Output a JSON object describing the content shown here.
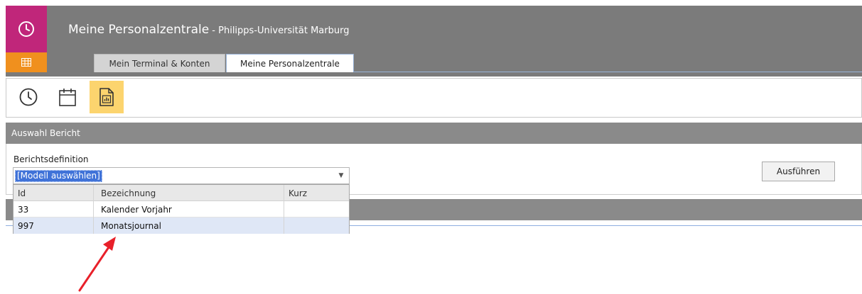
{
  "header": {
    "title": "Meine Personalzentrale",
    "subtitle": " - Philipps-Universität Marburg",
    "accent_colors": {
      "clock_tile": "#c0267a",
      "grid_tile": "#f0901e",
      "bar": "#7b7b7b"
    }
  },
  "side_icons": [
    "clock-icon",
    "grid-icon"
  ],
  "tabs": [
    {
      "label": "Mein Terminal & Konten",
      "active": false
    },
    {
      "label": "Meine Personalzentrale",
      "active": true
    }
  ],
  "toolbar": {
    "items": [
      {
        "icon": "clock-icon",
        "selected": false
      },
      {
        "icon": "calendar-icon",
        "selected": false
      },
      {
        "icon": "report-chart-icon",
        "selected": true
      }
    ],
    "selected_color": "#fcd46e"
  },
  "panel": {
    "title": "Auswahl Bericht",
    "field_label": "Berichtsdefinition",
    "select_value": "[Modell auswählen]",
    "run_label": "Ausführen"
  },
  "dropdown": {
    "columns": [
      "Id",
      "Bezeichnung",
      "Kurz"
    ],
    "rows": [
      {
        "id": "33",
        "name": "Kalender Vorjahr",
        "short": ""
      },
      {
        "id": "997",
        "name": "Monatsjournal",
        "short": ""
      }
    ],
    "highlight_color": "#dfe7f6"
  },
  "annotation": {
    "arrow_color": "#e8202a"
  }
}
